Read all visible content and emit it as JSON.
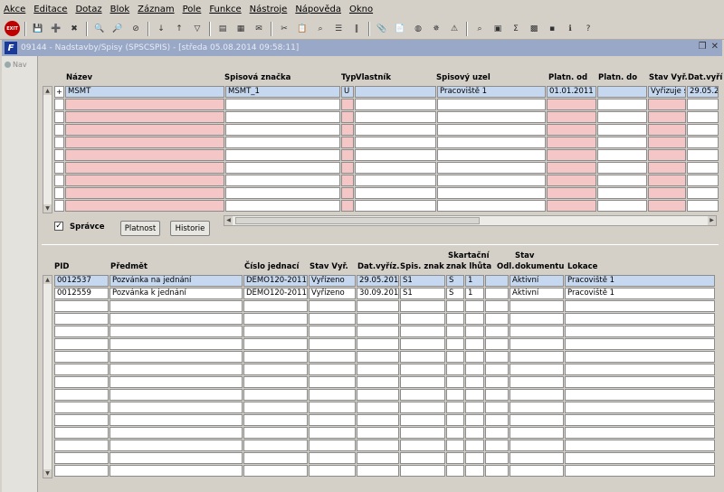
{
  "menu": [
    "Akce",
    "Editace",
    "Dotaz",
    "Blok",
    "Záznam",
    "Pole",
    "Funkce",
    "Nástroje",
    "Nápověda",
    "Okno"
  ],
  "toolbar": {
    "exit_label": "EXIT"
  },
  "window": {
    "title": "09144 - Nadstavby/Spisy (SPSCSPIS) - [středa 05.08.2014 09:58:11]"
  },
  "nav": {
    "label": "Nav"
  },
  "spisy": {
    "headers": {
      "nazev": "Název",
      "znacka": "Spisová značka",
      "typ": "Typ",
      "vlastnik": "Vlastník",
      "uzel": "Spisový uzel",
      "od": "Platn. od",
      "do": "Platn. do",
      "stav": "Stav Vyř.",
      "dat": "Dat.vyří"
    },
    "rows": [
      {
        "mark": "+",
        "nazev": "MŠMT",
        "znacka": "MSMT_1",
        "typ": "U",
        "vlastnik": "",
        "uzel": "Pracoviště 1",
        "od": "01.01.2011",
        "do": "",
        "stav": "Vyřizuje s",
        "dat": "29.05.20"
      }
    ]
  },
  "controls": {
    "spravce_label": "Správce",
    "platnost_button": "Platnost",
    "historie_button": "Historie"
  },
  "dokumenty": {
    "headers": {
      "pid": "PID",
      "predmet": "Předmět",
      "cj": "Číslo jednací",
      "stav": "Stav Vyř.",
      "dat": "Dat.vyříz.",
      "znak": "Spis. znak",
      "skart1": "Skartační",
      "skart2": "znak lhůta",
      "odl": "Odl.",
      "stavdok1": "Stav",
      "stavdok2": "dokumentu",
      "lokace": "Lokace"
    },
    "rows": [
      {
        "pid": "0012537",
        "predmet": "Pozvánka na jednání",
        "cj": "DEMO120-2011/0(",
        "stav": "Vyřízeno",
        "dat": "29.05.2014",
        "znak": "S1",
        "sz": "S",
        "lh": "1",
        "odl": "",
        "stavdok": "Aktivní",
        "lokace": "Pracoviště 1"
      },
      {
        "pid": "0012559",
        "predmet": "Pozvánka k jednání",
        "cj": "DEMO120-2011/0(",
        "stav": "Vyřízeno",
        "dat": "30.09.2011",
        "znak": "S1",
        "sz": "S",
        "lh": "1",
        "odl": "",
        "stavdok": "Aktivní",
        "lokace": "Pracoviště 1"
      }
    ]
  }
}
